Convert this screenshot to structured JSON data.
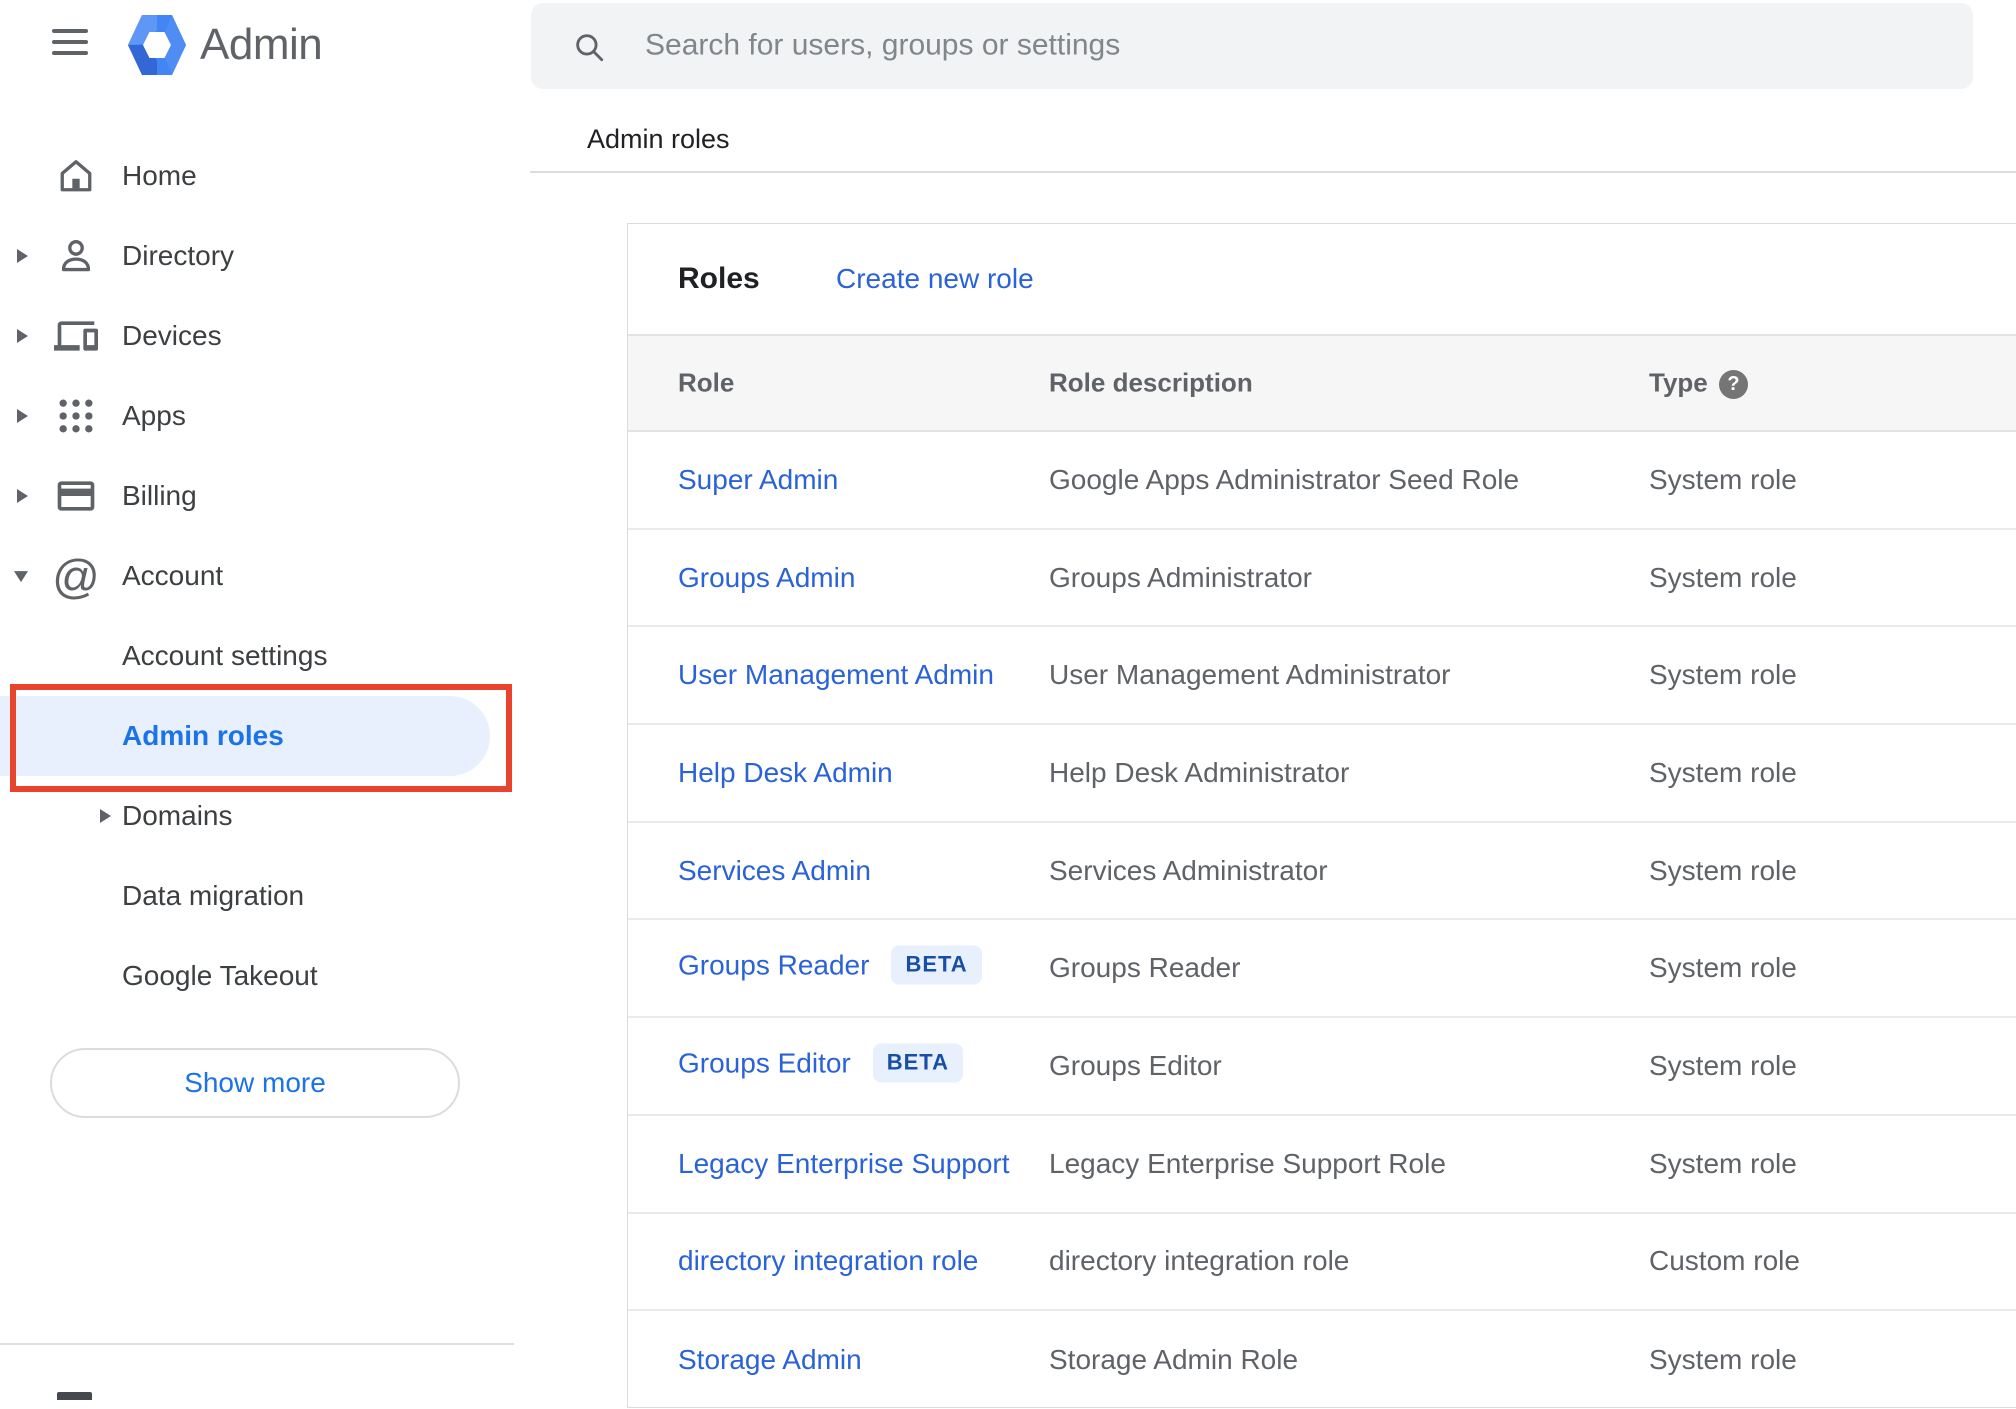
{
  "app": {
    "brand": "Admin"
  },
  "topbar": {
    "search_placeholder": "Search for users, groups or settings"
  },
  "breadcrumb": {
    "label": "Admin roles"
  },
  "sidebar": {
    "items": [
      {
        "label": "Home",
        "icon": "home-icon",
        "expand": null
      },
      {
        "label": "Directory",
        "icon": "person-icon",
        "expand": "collapsed"
      },
      {
        "label": "Devices",
        "icon": "devices-icon",
        "expand": "collapsed"
      },
      {
        "label": "Apps",
        "icon": "apps-grid-icon",
        "expand": "collapsed"
      },
      {
        "label": "Billing",
        "icon": "credit-card-icon",
        "expand": "collapsed"
      },
      {
        "label": "Account",
        "icon": "at-sign-icon",
        "expand": "expanded"
      }
    ],
    "sub_items": [
      {
        "label": "Account settings",
        "selected": false,
        "expand": null
      },
      {
        "label": "Admin roles",
        "selected": true,
        "expand": null,
        "annotated": true
      },
      {
        "label": "Domains",
        "selected": false,
        "expand": "collapsed"
      },
      {
        "label": "Data migration",
        "selected": false,
        "expand": null
      },
      {
        "label": "Google Takeout",
        "selected": false,
        "expand": null
      }
    ],
    "show_more_label": "Show more"
  },
  "roles_panel": {
    "title": "Roles",
    "create_link_label": "Create new role",
    "columns": [
      "Role",
      "Role description",
      "Type"
    ],
    "type_help_icon": "help-icon",
    "rows": [
      {
        "role": "Super Admin",
        "beta": false,
        "description": "Google Apps Administrator Seed Role",
        "type": "System role"
      },
      {
        "role": "Groups Admin",
        "beta": false,
        "description": "Groups Administrator",
        "type": "System role"
      },
      {
        "role": "User Management Admin",
        "beta": false,
        "description": "User Management Administrator",
        "type": "System role"
      },
      {
        "role": "Help Desk Admin",
        "beta": false,
        "description": "Help Desk Administrator",
        "type": "System role"
      },
      {
        "role": "Services Admin",
        "beta": false,
        "description": "Services Administrator",
        "type": "System role"
      },
      {
        "role": "Groups Reader",
        "beta": true,
        "beta_label": "BETA",
        "description": "Groups Reader",
        "type": "System role"
      },
      {
        "role": "Groups Editor",
        "beta": true,
        "beta_label": "BETA",
        "description": "Groups Editor",
        "type": "System role"
      },
      {
        "role": "Legacy Enterprise Support",
        "beta": false,
        "description": "Legacy Enterprise Support Role",
        "type": "System role"
      },
      {
        "role": "directory integration role",
        "beta": false,
        "description": "directory integration role",
        "type": "Custom role"
      },
      {
        "role": "Storage Admin",
        "beta": false,
        "description": "Storage Admin Role",
        "type": "System role"
      }
    ]
  },
  "colors": {
    "link_blue": "#2a62d7",
    "selected_blue": "#1a73e8",
    "selected_bg": "#e8f0fe",
    "beta_text": "#174ea6",
    "beta_bg": "#e8f0fe",
    "annotation_red": "#e8432c",
    "text_dark": "#202124",
    "text_gray": "#5f6368",
    "logo_blue": "#4285f4"
  }
}
